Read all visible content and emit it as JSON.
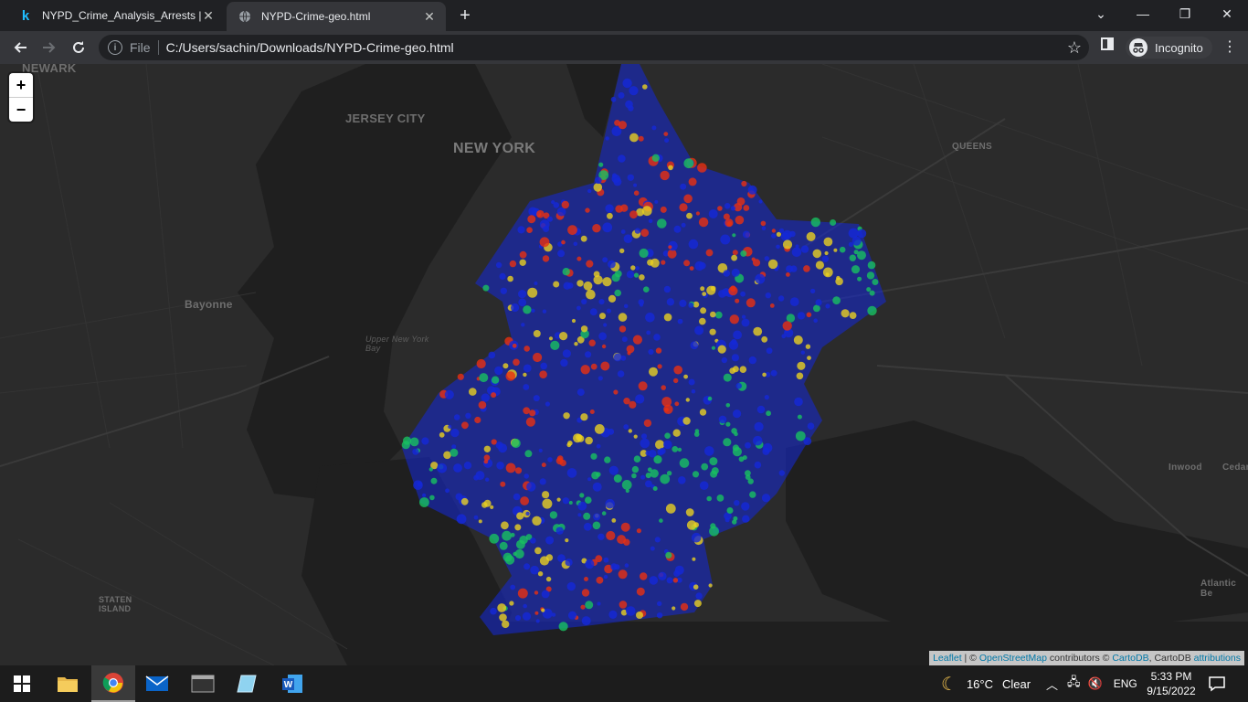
{
  "browser": {
    "tabs": [
      {
        "title": "NYPD_Crime_Analysis_Arrests | Ka",
        "favicon": "kaggle-icon",
        "active": false
      },
      {
        "title": "NYPD-Crime-geo.html",
        "favicon": "globe-icon",
        "active": true
      }
    ],
    "address": {
      "scheme": "File",
      "url": "C:/Users/sachin/Downloads/NYPD-Crime-geo.html"
    },
    "profile_label": "Incognito"
  },
  "map": {
    "labels": {
      "newark": "NEWARK",
      "jersey_city": "JERSEY CITY",
      "new_york": "NEW YORK",
      "queens": "QUEENS",
      "bayonne": "Bayonne",
      "upper_bay": "Upper New York Bay",
      "staten_island": "STATEN ISLAND",
      "inwood": "Inwood",
      "cedar": "Cedar",
      "atlantic_beach": "Atlantic Be"
    },
    "zoom_in": "+",
    "zoom_out": "−",
    "attribution": {
      "leaflet": "Leaflet",
      "sep1": " | © ",
      "osm": "OpenStreetMap",
      "mid": " contributors © ",
      "cartodb": "CartoDB",
      "mid2": ", CartoDB ",
      "attributions": "attributions"
    },
    "heat_colors": {
      "low": "#1428d8",
      "mid": "#18c060",
      "high": "#e8d020",
      "peak": "#e83010"
    }
  },
  "taskbar": {
    "weather_temp": "16°C",
    "weather_desc": "Clear",
    "language": "ENG",
    "time": "5:33 PM",
    "date": "9/15/2022"
  }
}
